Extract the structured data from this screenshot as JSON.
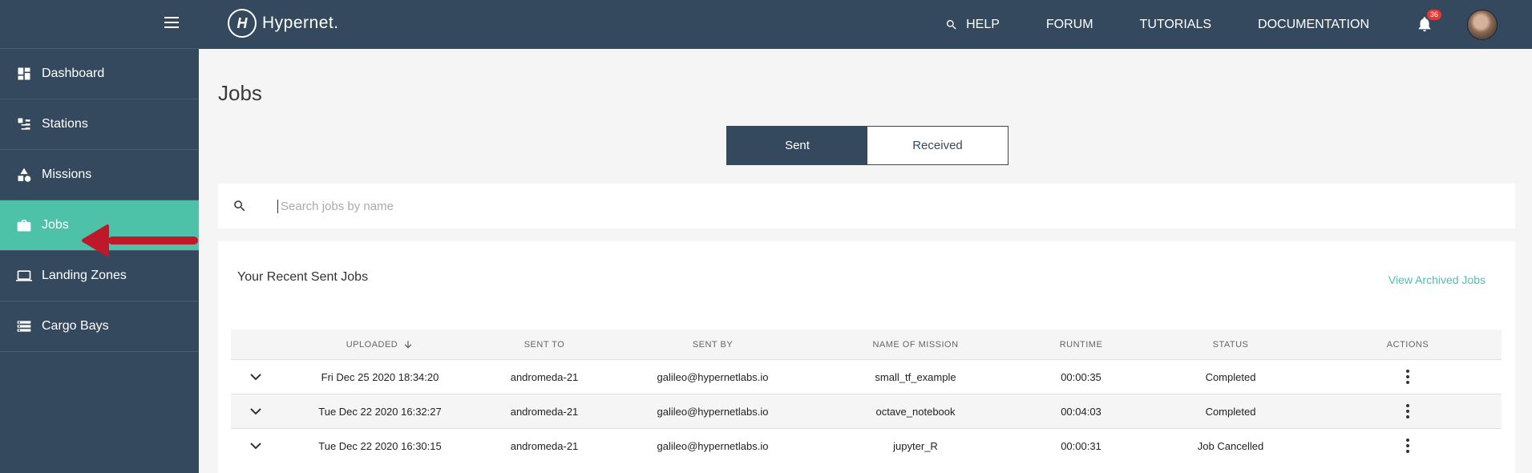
{
  "brand": {
    "name": "Hypernet.",
    "mark": "H"
  },
  "topnav": {
    "help": "HELP",
    "forum": "FORUM",
    "tutorials": "TUTORIALS",
    "documentation": "DOCUMENTATION",
    "notification_count": "36"
  },
  "sidebar": {
    "items": [
      {
        "label": "Dashboard",
        "icon": "dashboard-icon"
      },
      {
        "label": "Stations",
        "icon": "stations-icon"
      },
      {
        "label": "Missions",
        "icon": "missions-icon"
      },
      {
        "label": "Jobs",
        "icon": "briefcase-icon",
        "active": true
      },
      {
        "label": "Landing Zones",
        "icon": "laptop-icon"
      },
      {
        "label": "Cargo Bays",
        "icon": "storage-icon"
      }
    ]
  },
  "page": {
    "title": "Jobs",
    "tabs": {
      "sent": "Sent",
      "received": "Received"
    },
    "search_placeholder": "Search jobs by name",
    "section_title": "Your Recent Sent Jobs",
    "archived_link": "View Archived Jobs"
  },
  "table": {
    "headers": {
      "uploaded": "UPLOADED",
      "sent_to": "SENT TO",
      "sent_by": "SENT BY",
      "mission": "NAME OF MISSION",
      "runtime": "RUNTIME",
      "status": "STATUS",
      "actions": "ACTIONS"
    },
    "rows": [
      {
        "uploaded": "Fri Dec 25 2020 18:34:20",
        "sent_to": "andromeda-21",
        "sent_by": "galileo@hypernetlabs.io",
        "mission": "small_tf_example",
        "runtime": "00:00:35",
        "status": "Completed"
      },
      {
        "uploaded": "Tue Dec 22 2020 16:32:27",
        "sent_to": "andromeda-21",
        "sent_by": "galileo@hypernetlabs.io",
        "mission": "octave_notebook",
        "runtime": "00:04:03",
        "status": "Completed"
      },
      {
        "uploaded": "Tue Dec 22 2020 16:30:15",
        "sent_to": "andromeda-21",
        "sent_by": "galileo@hypernetlabs.io",
        "mission": "jupyter_R",
        "runtime": "00:00:31",
        "status": "Job Cancelled"
      }
    ]
  },
  "colors": {
    "navy": "#34495e",
    "accent": "#4ec1a9",
    "annotation_arrow": "#c0182b"
  }
}
